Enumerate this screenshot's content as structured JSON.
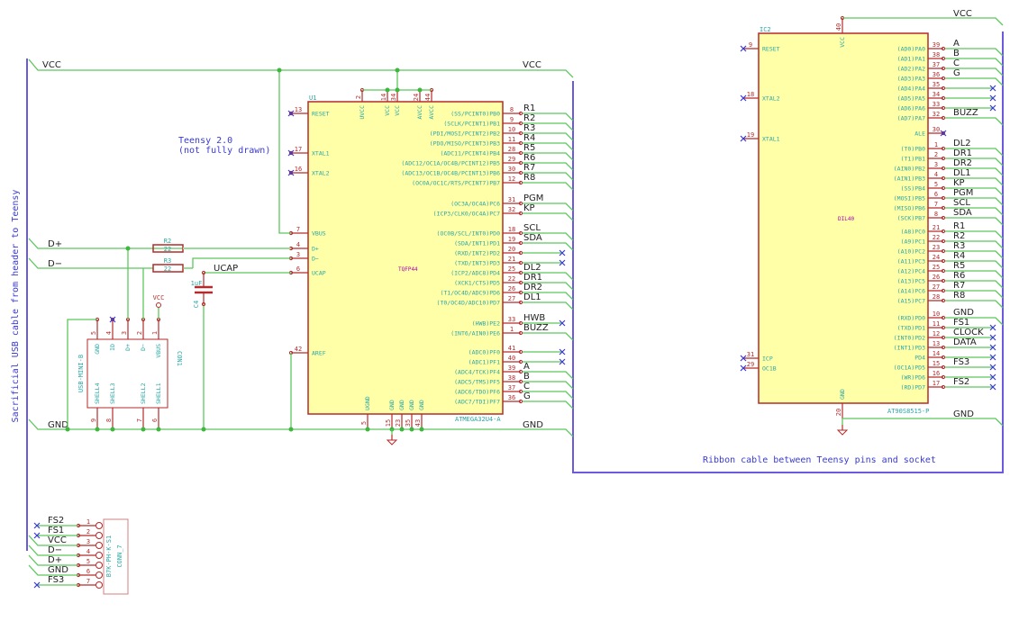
{
  "notes": {
    "teensy_line1": "Teensy 2.0",
    "teensy_line2": "(not fully drawn)",
    "left_bus": "Sacrificial USB cable from header to Teensy",
    "ribbon": "Ribbon cable between Teensy pins and socket"
  },
  "colors": {
    "wire": "#5cc85c",
    "pin": "#b52a2a",
    "body": "#ffffa8",
    "bus": "#6a5ae0",
    "pin_name": "#2aa6a6"
  },
  "nets": {
    "vcc_left": "VCC",
    "vcc_right": "VCC",
    "vcc_ic2": "VCC",
    "gnd_left": "GND",
    "gnd_u1": "GND",
    "gnd_ic2": "GND",
    "dplus": "D+",
    "dminus": "D−",
    "ucap": "UCAP"
  },
  "u1": {
    "ref": "U1",
    "value": "ATMEGA32U4-A",
    "footprint": "TQFP44",
    "left_pins": [
      {
        "num": "13",
        "name": "RESET",
        "nc": true
      },
      {
        "num": "17",
        "name": "XTAL1",
        "nc": true
      },
      {
        "num": "16",
        "name": "XTAL2",
        "nc": true
      },
      {
        "num": "7",
        "name": "VBUS"
      },
      {
        "num": "4",
        "name": "D+"
      },
      {
        "num": "3",
        "name": "D−"
      },
      {
        "num": "6",
        "name": "UCAP"
      },
      {
        "num": "42",
        "name": "AREF"
      }
    ],
    "top_pins": [
      {
        "num": "2",
        "name": "UVCC"
      },
      {
        "num": "14",
        "name": "VCC"
      },
      {
        "num": "34",
        "name": "VCC"
      },
      {
        "num": "24",
        "name": "AVCC"
      },
      {
        "num": "44",
        "name": "AVCC"
      }
    ],
    "bottom_pins": [
      {
        "num": "5",
        "name": "UGND"
      },
      {
        "num": "15",
        "name": "GND"
      },
      {
        "num": "23",
        "name": "GND"
      },
      {
        "num": "35",
        "name": "GND"
      },
      {
        "num": "43",
        "name": "GND"
      }
    ],
    "right_pins": [
      {
        "num": "8",
        "name": "(SS/PCINT0)PB0",
        "net": "R1"
      },
      {
        "num": "9",
        "name": "(SCLK/PCINT1)PB1",
        "net": "R2"
      },
      {
        "num": "10",
        "name": "(PDI/MOSI/PCINT2)PB2",
        "net": "R3"
      },
      {
        "num": "11",
        "name": "(PDO/MISO/PCINT3)PB3",
        "net": "R4"
      },
      {
        "num": "28",
        "name": "(ADC11/PCINT4)PB4",
        "net": "R5"
      },
      {
        "num": "29",
        "name": "(ADC12/OC1A/OC4B/PCINT12)PB5",
        "net": "R6"
      },
      {
        "num": "30",
        "name": "(ADC13/OC1B/OC4B/PCINT13)PB6",
        "net": "R7"
      },
      {
        "num": "12",
        "name": "(OC0A/OC1C/RTS/PCINT7)PB7",
        "net": "R8"
      },
      {
        "num": "31",
        "name": "(OC3A/OC4A)PC6",
        "net": "PGM"
      },
      {
        "num": "32",
        "name": "(ICP3/CLK0/OC4A)PC7",
        "net": "KP"
      },
      {
        "num": "18",
        "name": "(OC0B/SCL/INT0)PD0",
        "net": "SCL"
      },
      {
        "num": "19",
        "name": "(SDA/INT1)PD1",
        "net": "SDA"
      },
      {
        "num": "20",
        "name": "(RXD/INT2)PD2",
        "net": "",
        "nc": true
      },
      {
        "num": "21",
        "name": "(TXD/INT3)PD3",
        "net": "",
        "nc": true
      },
      {
        "num": "25",
        "name": "(ICP2/ADC8)PD4",
        "net": "DL2"
      },
      {
        "num": "22",
        "name": "(XCK1/CTS)PD5",
        "net": "DR1"
      },
      {
        "num": "26",
        "name": "(T1/OC4D/ADC9)PD6",
        "net": "DR2"
      },
      {
        "num": "27",
        "name": "(T0/OC4D/ADC10)PD7",
        "net": "DL1"
      },
      {
        "num": "33",
        "name": "(HWB)PE2",
        "net": "HWB",
        "nc": true
      },
      {
        "num": "1",
        "name": "(INT6/AIN0)PE6",
        "net": "BUZZ"
      },
      {
        "num": "41",
        "name": "(ADC0)PF0",
        "net": "",
        "nc": true
      },
      {
        "num": "40",
        "name": "(ADC1)PF1",
        "net": "",
        "nc": true
      },
      {
        "num": "39",
        "name": "(ADC4/TCK)PF4",
        "net": "A"
      },
      {
        "num": "38",
        "name": "(ADC5/TMS)PF5",
        "net": "B"
      },
      {
        "num": "37",
        "name": "(ADC6/TDO)PF6",
        "net": "C"
      },
      {
        "num": "36",
        "name": "(ADC7/TDI)PF7",
        "net": "G"
      }
    ]
  },
  "ic2": {
    "ref": "IC2",
    "value": "AT90S8515-P",
    "footprint": "DIL40",
    "top_pin": {
      "num": "40",
      "name": "VCC"
    },
    "bottom_pin": {
      "num": "20",
      "name": "GND"
    },
    "left_pins": [
      {
        "num": "9",
        "name": "RESET"
      },
      {
        "num": "18",
        "name": "XTAL2"
      },
      {
        "num": "19",
        "name": "XTAL1"
      },
      {
        "num": "31",
        "name": "ICP"
      },
      {
        "num": "29",
        "name": "OC1B"
      }
    ],
    "right_pins": [
      {
        "num": "39",
        "name": "(AD0)PA0",
        "net": "A"
      },
      {
        "num": "38",
        "name": "(AD1)PA1",
        "net": "B"
      },
      {
        "num": "37",
        "name": "(AD2)PA2",
        "net": "C"
      },
      {
        "num": "36",
        "name": "(AD3)PA3",
        "net": "G"
      },
      {
        "num": "35",
        "name": "(AD4)PA4",
        "net": "",
        "nc": true
      },
      {
        "num": "34",
        "name": "(AD5)PA5",
        "net": "",
        "nc": true
      },
      {
        "num": "33",
        "name": "(AD6)PA6",
        "net": "",
        "nc": true
      },
      {
        "num": "32",
        "name": "(AD7)PA7",
        "net": "BUZZ"
      },
      {
        "num": "30",
        "name": "ALE",
        "net": "",
        "nc": true,
        "direct": true
      },
      {
        "num": "1",
        "name": "(T0)PB0",
        "net": "DL2"
      },
      {
        "num": "2",
        "name": "(T1)PB1",
        "net": "DR1"
      },
      {
        "num": "3",
        "name": "(AIN0)PB2",
        "net": "DR2"
      },
      {
        "num": "4",
        "name": "(AIN1)PB3",
        "net": "DL1"
      },
      {
        "num": "5",
        "name": "(SS)PB4",
        "net": "KP"
      },
      {
        "num": "6",
        "name": "(MOSI)PB5",
        "net": "PGM"
      },
      {
        "num": "7",
        "name": "(MISO)PB6",
        "net": "SCL"
      },
      {
        "num": "8",
        "name": "(SCK)PB7",
        "net": "SDA"
      },
      {
        "num": "21",
        "name": "(A8)PC0",
        "net": "R1"
      },
      {
        "num": "22",
        "name": "(A9)PC1",
        "net": "R2"
      },
      {
        "num": "23",
        "name": "(A10)PC2",
        "net": "R3"
      },
      {
        "num": "24",
        "name": "(A11)PC3",
        "net": "R4"
      },
      {
        "num": "25",
        "name": "(A12)PC4",
        "net": "R5"
      },
      {
        "num": "26",
        "name": "(A13)PC5",
        "net": "R6"
      },
      {
        "num": "27",
        "name": "(A14)PC6",
        "net": "R7"
      },
      {
        "num": "28",
        "name": "(A15)PC7",
        "net": "R8"
      },
      {
        "num": "10",
        "name": "(RXD)PD0",
        "net": "GND"
      },
      {
        "num": "11",
        "name": "(TXD)PD1",
        "net": "FS1",
        "nc": true
      },
      {
        "num": "12",
        "name": "(INT0)PD2",
        "net": "CLOCK",
        "nc": true
      },
      {
        "num": "13",
        "name": "(INT1)PD3",
        "net": "DATA",
        "nc": true
      },
      {
        "num": "14",
        "name": "PD4",
        "net": "",
        "nc": true
      },
      {
        "num": "15",
        "name": "(OC1A)PD5",
        "net": "FS3",
        "nc": true
      },
      {
        "num": "16",
        "name": "(WR)PD6",
        "net": "",
        "nc": true
      },
      {
        "num": "17",
        "name": "(RD)PD7",
        "net": "FS2",
        "nc": true
      }
    ]
  },
  "r2": {
    "ref": "R2",
    "value": "22"
  },
  "r3": {
    "ref": "R3",
    "value": "22"
  },
  "c4": {
    "ref": "C4",
    "value": "1uF"
  },
  "con1": {
    "ref": "CON1",
    "value": "USB-MINI-B",
    "vbus_power": "VCC",
    "top_pins": [
      {
        "num": "5",
        "name": "GND"
      },
      {
        "num": "4",
        "name": "ID"
      },
      {
        "num": "3",
        "name": "D+"
      },
      {
        "num": "2",
        "name": "D−"
      },
      {
        "num": "1",
        "name": "VBUS"
      }
    ],
    "bottom_pins": [
      {
        "num": "9",
        "name": "SHELL4"
      },
      {
        "num": "8",
        "name": "SHELL3"
      },
      {
        "num": "7",
        "name": "SHELL2"
      },
      {
        "num": "6",
        "name": "SHELL1"
      }
    ]
  },
  "conn7": {
    "ref": "CONN_7",
    "value": "B7K-PH-K-S1",
    "pins": [
      {
        "num": "1",
        "net": "FS2",
        "nc": true
      },
      {
        "num": "2",
        "net": "FS1",
        "nc": true
      },
      {
        "num": "3",
        "net": "VCC"
      },
      {
        "num": "4",
        "net": "D−"
      },
      {
        "num": "5",
        "net": "D+"
      },
      {
        "num": "6",
        "net": "GND"
      },
      {
        "num": "7",
        "net": "FS3",
        "nc": true
      }
    ]
  }
}
